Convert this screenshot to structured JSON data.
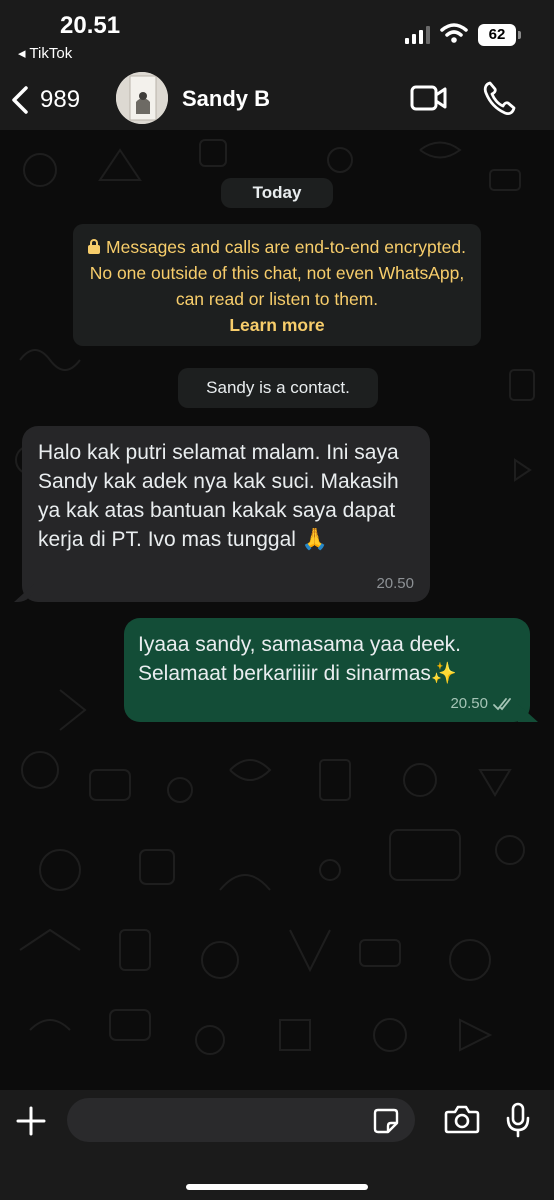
{
  "status_bar": {
    "time": "20.51",
    "back_app": "◂ TikTok",
    "battery": "62"
  },
  "header": {
    "back_count": "989",
    "contact_name": "Sandy B"
  },
  "chat": {
    "date_label": "Today",
    "encryption_notice": "Messages and calls are end-to-end encrypted. No one outside of this chat, not even WhatsApp, can read or listen to them.",
    "learn_more": "Learn more",
    "contact_notice": "Sandy is a contact.",
    "messages": [
      {
        "direction": "incoming",
        "text": "Halo kak putri selamat malam. Ini saya Sandy kak adek nya kak suci. Makasih ya kak atas bantuan kakak saya dapat kerja di PT. Ivo mas tunggal 🙏",
        "time": "20.50"
      },
      {
        "direction": "outgoing",
        "text": "Iyaaa sandy, samasama yaa deek. Selamaat berkariiiir di sinarmas✨",
        "time": "20.50",
        "status": "read"
      }
    ]
  },
  "input": {
    "placeholder": ""
  },
  "colors": {
    "header_bg": "#1b1b1b",
    "incoming_bubble": "#262628",
    "outgoing_bubble": "#134d37",
    "encryption_text": "#f7cd6b",
    "read_ticks": "#a5c4b6"
  }
}
